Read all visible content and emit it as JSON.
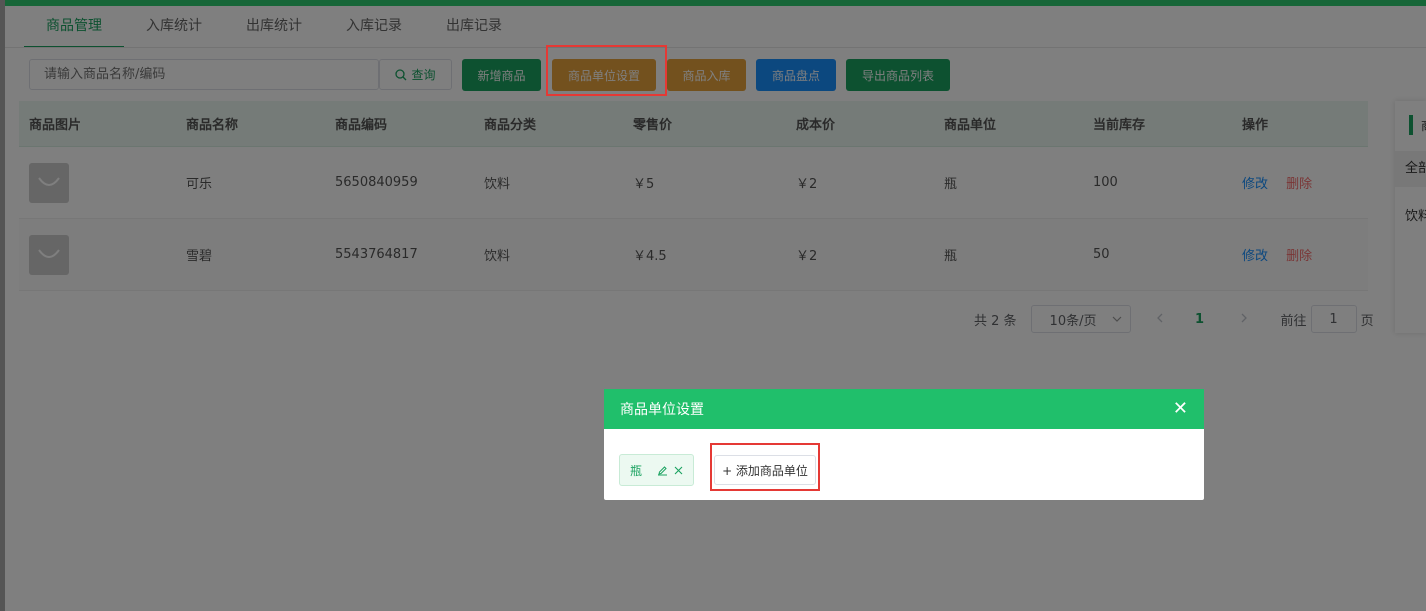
{
  "tabs": [
    {
      "label": "商品管理",
      "active": true
    },
    {
      "label": "入库统计",
      "active": false
    },
    {
      "label": "出库统计",
      "active": false
    },
    {
      "label": "入库记录",
      "active": false
    },
    {
      "label": "出库记录",
      "active": false
    }
  ],
  "search": {
    "placeholder": "请输入商品名称/编码",
    "query_label": "查询"
  },
  "toolbar": {
    "add_product": "新增商品",
    "unit_settings": "商品单位设置",
    "stock_in": "商品入库",
    "inventory_check": "商品盘点",
    "export_list": "导出商品列表"
  },
  "table": {
    "headers": [
      "商品图片",
      "商品名称",
      "商品编码",
      "商品分类",
      "零售价",
      "成本价",
      "商品单位",
      "当前库存",
      "操作"
    ],
    "rows": [
      {
        "name": "可乐",
        "code": "5650840959",
        "category": "饮料",
        "retail": "￥5",
        "cost": "￥2",
        "unit": "瓶",
        "stock": "100"
      },
      {
        "name": "雪碧",
        "code": "5543764817",
        "category": "饮料",
        "retail": "￥4.5",
        "cost": "￥2",
        "unit": "瓶",
        "stock": "50"
      }
    ],
    "edit_label": "修改",
    "delete_label": "删除"
  },
  "pagination": {
    "total": "共 2 条",
    "page_size": "10条/页",
    "current_page": "1",
    "goto_label": "前往",
    "goto_value": "1",
    "page_suffix": "页"
  },
  "side_panel": {
    "header_cut": "商",
    "all_label": "全部",
    "drink_label": "饮料"
  },
  "dialog": {
    "title": "商品单位设置",
    "unit_tag": "瓶",
    "add_unit_label": "+ 添加商品单位"
  },
  "colors": {
    "accent_green": "#1aa260",
    "dialog_header": "#20bf6b",
    "orange": "#e6a23c",
    "blue": "#1890ff",
    "highlight_red": "#e53935"
  }
}
